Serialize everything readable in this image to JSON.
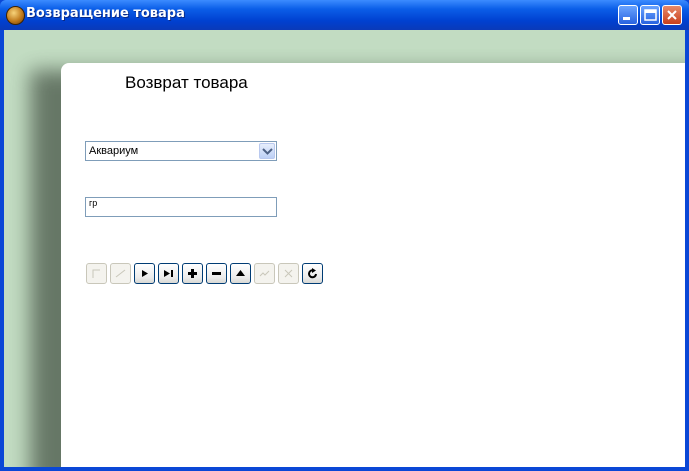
{
  "window": {
    "title": "Возвращение товара"
  },
  "form": {
    "heading": "Возврат товара",
    "department_combo": {
      "value": "Аквариум"
    },
    "field": {
      "value": "гр"
    }
  },
  "navigator": {
    "buttons": [
      {
        "name": "first",
        "icon": "first-record-icon",
        "enabled": false
      },
      {
        "name": "prior",
        "icon": "prior-record-icon",
        "enabled": false
      },
      {
        "name": "next",
        "icon": "next-record-icon",
        "enabled": true
      },
      {
        "name": "last",
        "icon": "last-record-icon",
        "enabled": true
      },
      {
        "name": "insert",
        "icon": "plus-icon",
        "enabled": true
      },
      {
        "name": "delete",
        "icon": "minus-icon",
        "enabled": true
      },
      {
        "name": "edit",
        "icon": "up-triangle-icon",
        "enabled": true
      },
      {
        "name": "post",
        "icon": "check-icon",
        "enabled": false
      },
      {
        "name": "cancel",
        "icon": "cancel-icon",
        "enabled": false
      },
      {
        "name": "refresh",
        "icon": "refresh-icon",
        "enabled": true
      }
    ]
  }
}
